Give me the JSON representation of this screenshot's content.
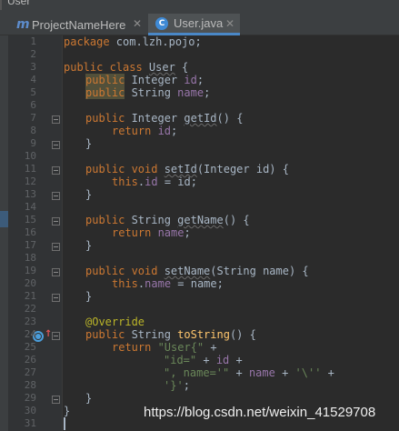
{
  "window": {
    "title": "User"
  },
  "tabs": [
    {
      "label": "ProjectNameHere",
      "icon": "m-module-icon",
      "active": false
    },
    {
      "label": "User.java",
      "icon": "java-class-icon",
      "active": true
    }
  ],
  "gutter": {
    "line_numbers": [
      "1",
      "2",
      "3",
      "4",
      "5",
      "6",
      "7",
      "8",
      "9",
      "10",
      "11",
      "12",
      "13",
      "14",
      "15",
      "16",
      "17",
      "18",
      "19",
      "20",
      "21",
      "22",
      "23",
      "24",
      "25",
      "26",
      "27",
      "28",
      "29",
      "30",
      "31"
    ]
  },
  "code": {
    "l1_kw": "package",
    "l1_rest": " com.lzh.pojo;",
    "l3_kw": "public class ",
    "l3_name": "User",
    "l3_rest": " {",
    "l4_kw": "public",
    "l4_rest": " Integer ",
    "l4_fld": "id",
    "l4_end": ";",
    "l5_kw": "public",
    "l5_rest": " String ",
    "l5_fld": "name",
    "l5_end": ";",
    "l7_kw": "public",
    "l7_rest": " Integer ",
    "l7_fn": "getId",
    "l7_end": "() {",
    "l8_kw": "return ",
    "l8_fld": "id",
    "l8_end": ";",
    "l9": "}",
    "l11_kw": "public void ",
    "l11_fn": "setId",
    "l11_end": "(Integer id) {",
    "l12_kw": "this",
    "l12_dot": ".",
    "l12_fld": "id",
    "l12_end": " = id;",
    "l13": "}",
    "l15_kw": "public",
    "l15_rest": " String ",
    "l15_fn": "getName",
    "l15_end": "() {",
    "l16_kw": "return ",
    "l16_fld": "name",
    "l16_end": ";",
    "l17": "}",
    "l19_kw": "public void ",
    "l19_fn": "setName",
    "l19_end": "(String name) {",
    "l20_kw": "this",
    "l20_dot": ".",
    "l20_fld": "name",
    "l20_end": " = name;",
    "l21": "}",
    "l23_ann": "@Override",
    "l24_kw": "public",
    "l24_rest": " String ",
    "l24_fn": "toString",
    "l24_end": "() {",
    "l25_kw": "return ",
    "l25_str": "\"User{\"",
    "l25_end": " +",
    "l26_str": "\"id=\"",
    "l26_mid": " + ",
    "l26_fld": "id",
    "l26_end": " +",
    "l27_str": "\", name='\"",
    "l27_mid": " + ",
    "l27_fld": "name",
    "l27_mid2": " + ",
    "l27_str2": "'\\''",
    "l27_end": " +",
    "l28_str": "'}'",
    "l28_end": ";",
    "l29": "}",
    "l30": "}"
  },
  "watermark": "https://blog.csdn.net/weixin_41529708",
  "colors": {
    "background": "#2b2b2b",
    "keyword": "#cc7832",
    "field": "#9876aa",
    "string": "#6a8759",
    "annotation": "#bbb529",
    "method": "#ffc66d",
    "text": "#a9b7c6"
  }
}
